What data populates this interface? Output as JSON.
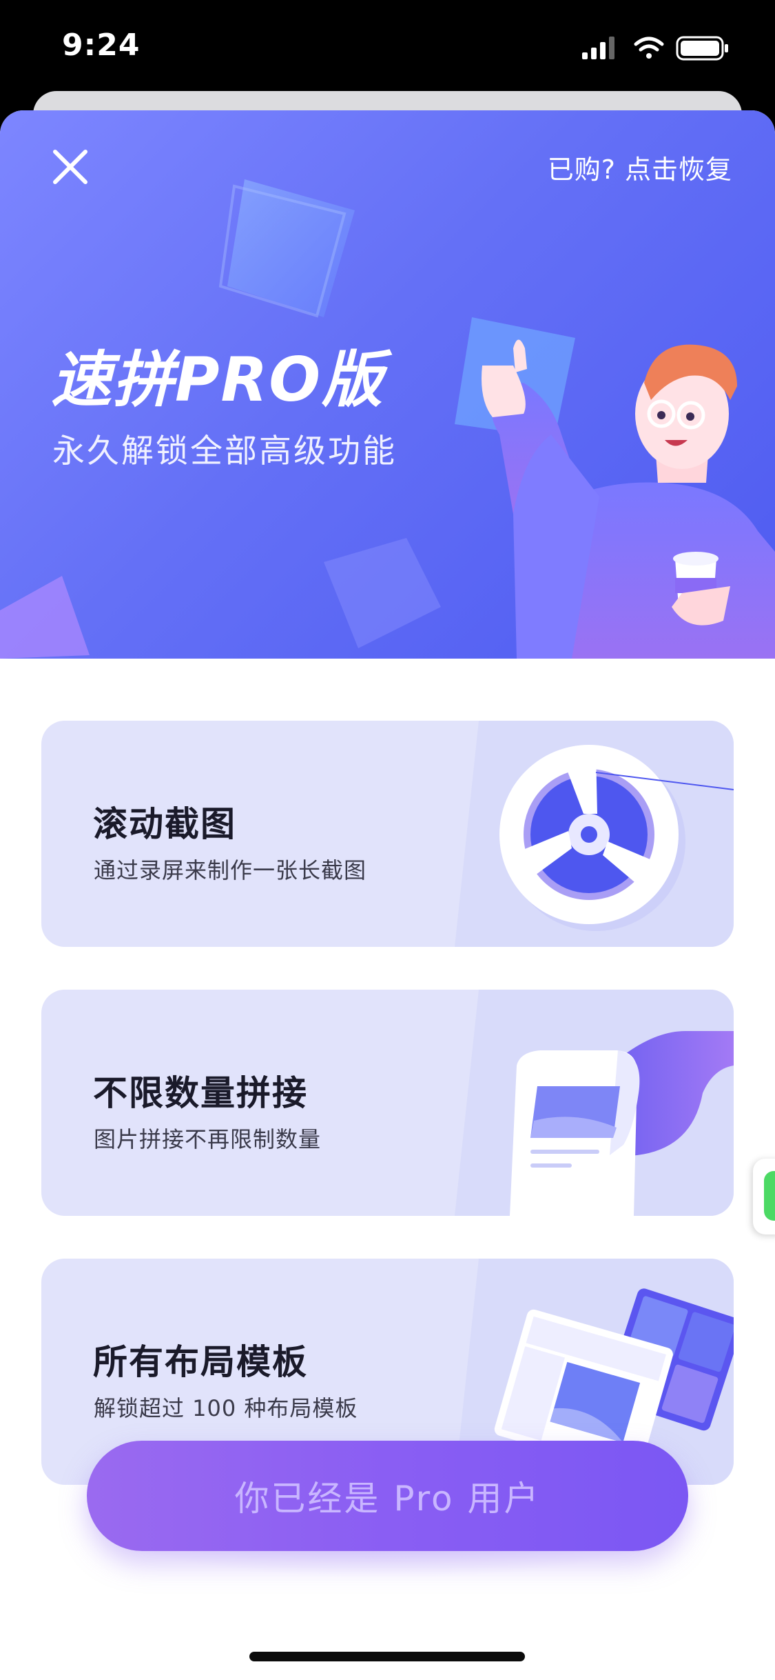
{
  "status_bar": {
    "time": "9:24"
  },
  "header": {
    "restore_label": "已购? 点击恢复"
  },
  "hero": {
    "title": "速拼PRO版",
    "subtitle": "永久解锁全部高级功能"
  },
  "features": [
    {
      "title": "滚动截图",
      "desc": "通过录屏来制作一张长截图",
      "icon": "film-reel-icon"
    },
    {
      "title": "不限数量拼接",
      "desc": "图片拼接不再限制数量",
      "icon": "paper-scroll-icon"
    },
    {
      "title": "所有布局模板",
      "desc": "解锁超过 100 种布局模板",
      "icon": "layout-grid-icon"
    }
  ],
  "cta": {
    "label": "你已经是 Pro 用户"
  },
  "colors": {
    "hero_start": "#7d86ff",
    "hero_end": "#4e5bf1",
    "card_bg": "#e1e3fb",
    "cta_start": "#9a6af0",
    "cta_end": "#7b57f3"
  }
}
